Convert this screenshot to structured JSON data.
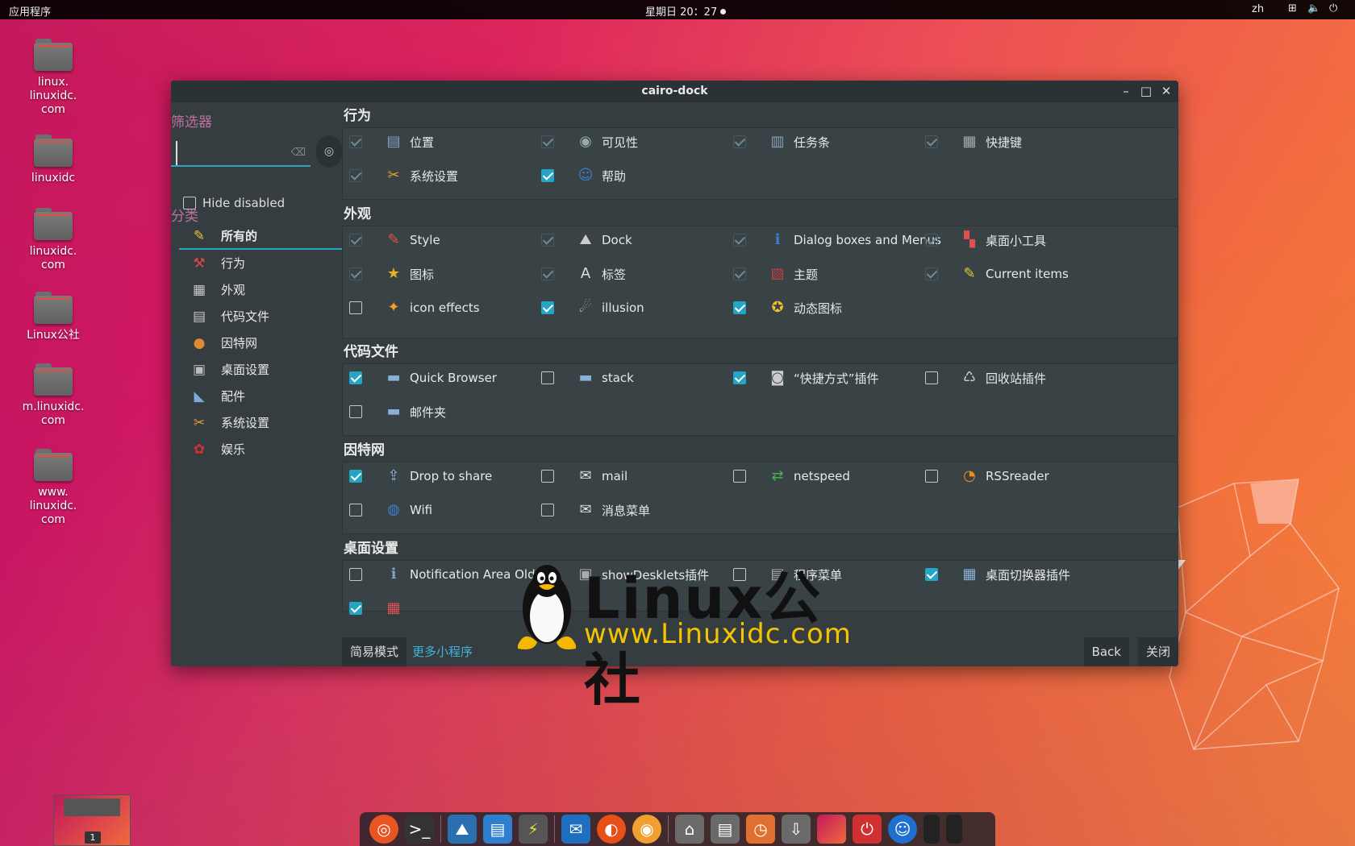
{
  "topbar": {
    "apps_label": "应用程序",
    "clock": "星期日 20：27",
    "lang": "zh"
  },
  "desktop_icons": [
    {
      "label": "linux.\nlinuxidc.\ncom"
    },
    {
      "label": "linuxidc"
    },
    {
      "label": "linuxidc.\ncom"
    },
    {
      "label": "Linux公社"
    },
    {
      "label": "m.linuxidc.\ncom"
    },
    {
      "label": "www.\nlinuxidc.\ncom"
    }
  ],
  "window": {
    "title": "cairo-dock",
    "minimize": "–",
    "maximize": "□",
    "close": "✕"
  },
  "sidebar": {
    "filter_header": "筛选器",
    "search_value": "",
    "hide_disabled_label": "Hide disabled",
    "hide_disabled_checked": false,
    "category_header": "分类",
    "categories": [
      {
        "label": "所有的",
        "icon": "all-items-icon",
        "glyph": "✎",
        "color": "#e6c33a"
      },
      {
        "label": "行为",
        "icon": "behaviour-icon",
        "glyph": "⚒",
        "color": "#d84848"
      },
      {
        "label": "外观",
        "icon": "appearance-icon",
        "glyph": "▦",
        "color": "#c8c8c8"
      },
      {
        "label": "代码文件",
        "icon": "files-icon",
        "glyph": "▤",
        "color": "#c8c8c8"
      },
      {
        "label": "因特网",
        "icon": "internet-icon",
        "glyph": "●",
        "color": "#e08a35"
      },
      {
        "label": "桌面设置",
        "icon": "desktop-icon",
        "glyph": "▣",
        "color": "#bbbbbb"
      },
      {
        "label": "配件",
        "icon": "accessories-icon",
        "glyph": "◣",
        "color": "#7fa8d8"
      },
      {
        "label": "系统设置",
        "icon": "system-icon",
        "glyph": "✂",
        "color": "#e0a030"
      },
      {
        "label": "娱乐",
        "icon": "fun-icon",
        "glyph": "✿",
        "color": "#d83030"
      }
    ]
  },
  "sections": [
    {
      "title": "行为",
      "items": [
        {
          "label": "位置",
          "state": "dim",
          "glyph": "▤",
          "color": "#7fa0c8"
        },
        {
          "label": "可见性",
          "state": "dim",
          "glyph": "◉",
          "color": "#9aa"
        },
        {
          "label": "任务条",
          "state": "dim",
          "glyph": "▥",
          "color": "#8aa0c0"
        },
        {
          "label": "快捷键",
          "state": "dim",
          "glyph": "▦",
          "color": "#aaa"
        },
        {
          "label": "系统设置",
          "state": "dim",
          "glyph": "✂",
          "color": "#e0a030"
        },
        {
          "label": "帮助",
          "state": "on",
          "glyph": "☺",
          "color": "#3a7fd0"
        }
      ]
    },
    {
      "title": "外观",
      "items": [
        {
          "label": "Style",
          "state": "dim",
          "glyph": "✎",
          "color": "#e05050"
        },
        {
          "label": "Dock",
          "state": "dim",
          "glyph": "⛰",
          "color": "#ccc"
        },
        {
          "label": "Dialog boxes and Menus",
          "state": "dim",
          "glyph": "ℹ",
          "color": "#3a7fd0"
        },
        {
          "label": "桌面小工具",
          "state": "dim",
          "glyph": "▚",
          "color": "#e05050"
        },
        {
          "label": "图标",
          "state": "dim",
          "glyph": "★",
          "color": "#f0b020"
        },
        {
          "label": "标签",
          "state": "dim",
          "glyph": "A",
          "color": "#ddd"
        },
        {
          "label": "主题",
          "state": "dim",
          "glyph": "▧",
          "color": "#c04040"
        },
        {
          "label": "Current items",
          "state": "dim",
          "glyph": "✎",
          "color": "#e6c33a"
        },
        {
          "label": "icon effects",
          "state": "off",
          "glyph": "✦",
          "color": "#f0a020"
        },
        {
          "label": "illusion",
          "state": "on",
          "glyph": "☄",
          "color": "#bbb"
        },
        {
          "label": "动态图标",
          "state": "on",
          "glyph": "✪",
          "color": "#f0c030"
        }
      ]
    },
    {
      "title": "代码文件",
      "items": [
        {
          "label": "Quick Browser",
          "state": "on",
          "glyph": "▬",
          "color": "#8ab0d8"
        },
        {
          "label": "stack",
          "state": "off",
          "glyph": "▬",
          "color": "#8ab0d8"
        },
        {
          "label": "“快捷方式”插件",
          "state": "on",
          "glyph": "◙",
          "color": "#ccc"
        },
        {
          "label": "回收站插件",
          "state": "off",
          "glyph": "♺",
          "color": "#ccc"
        },
        {
          "label": "邮件夹",
          "state": "off",
          "glyph": "▬",
          "color": "#8ab0d8"
        }
      ]
    },
    {
      "title": "因特网",
      "items": [
        {
          "label": "Drop to share",
          "state": "on",
          "glyph": "⇪",
          "color": "#8ab0d8"
        },
        {
          "label": "mail",
          "state": "off",
          "glyph": "✉",
          "color": "#ddd"
        },
        {
          "label": "netspeed",
          "state": "off",
          "glyph": "⇄",
          "color": "#4caf50"
        },
        {
          "label": "RSSreader",
          "state": "off",
          "glyph": "◔",
          "color": "#f08a20"
        },
        {
          "label": "Wifi",
          "state": "off",
          "glyph": "◍",
          "color": "#3a7fd0"
        },
        {
          "label": "消息菜单",
          "state": "off",
          "glyph": "✉",
          "color": "#ddd"
        }
      ]
    },
    {
      "title": "桌面设置",
      "items": [
        {
          "label": "Notification Area Old",
          "state": "off",
          "glyph": "ℹ",
          "color": "#7fa0c8"
        },
        {
          "label": "showDesklets插件",
          "state": "on",
          "glyph": "▣",
          "color": "#aaa"
        },
        {
          "label": "程序菜单",
          "state": "off",
          "glyph": "▤",
          "color": "#aaa"
        },
        {
          "label": "桌面切换器插件",
          "state": "on",
          "glyph": "▦",
          "color": "#8ab0d8"
        },
        {
          "label": "",
          "state": "on",
          "glyph": "▦",
          "color": "#e05050"
        }
      ]
    }
  ],
  "footer": {
    "simple_mode": "简易模式",
    "more_applets": "更多小程序",
    "back": "Back",
    "close": "关闭"
  },
  "watermark": {
    "line1": "Linux公社",
    "line2": "www.Linuxidc.com"
  },
  "workspace": {
    "number": "1"
  }
}
